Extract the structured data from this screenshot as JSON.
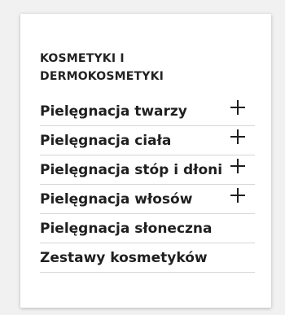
{
  "panel": {
    "heading": "KOSMETYKI I DERMOKOSMETYKI"
  },
  "menu": {
    "items": [
      {
        "label": "Pielęgnacja twarzy",
        "expandable": true
      },
      {
        "label": "Pielęgnacja ciała",
        "expandable": true
      },
      {
        "label": "Pielęgnacja stóp i dłoni",
        "expandable": true
      },
      {
        "label": "Pielęgnacja włosów",
        "expandable": true
      },
      {
        "label": "Pielęgnacja słoneczna",
        "expandable": false
      },
      {
        "label": "Zestawy kosmetyków",
        "expandable": false
      }
    ]
  },
  "icons": {
    "expand": "plus-icon"
  }
}
